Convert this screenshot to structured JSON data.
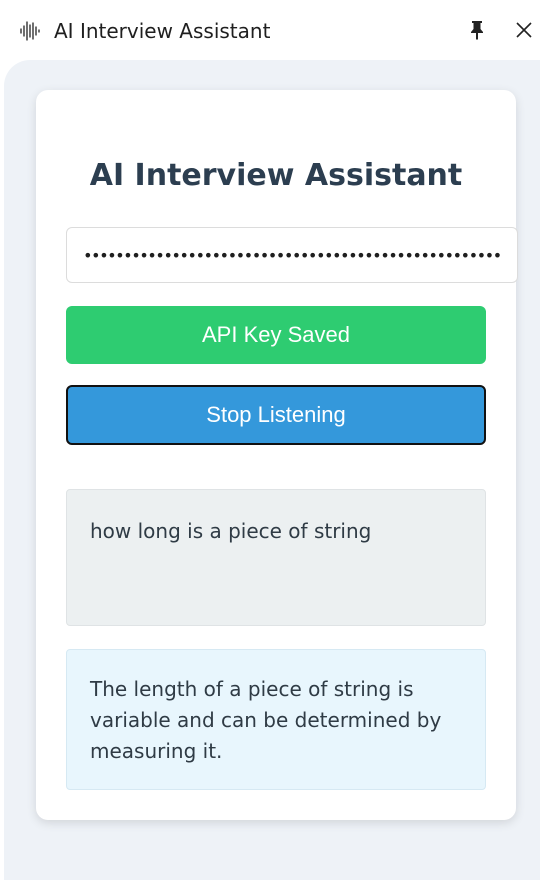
{
  "window": {
    "title": "AI Interview Assistant",
    "app_icon": "audio-waveform-icon",
    "pin_icon": "pin-icon",
    "close_icon": "close-icon"
  },
  "card": {
    "heading": "AI Interview Assistant",
    "api_key_input": {
      "value": "••••••••••••••••••••••••••••••••••••••••••••••••••••••••"
    },
    "api_key_button": {
      "label": "API Key Saved",
      "color": "#2ecc71"
    },
    "listen_button": {
      "label": "Stop Listening",
      "color": "#3498db"
    },
    "question": {
      "text": "how long is a piece of string",
      "background": "#ecf0f1"
    },
    "answer": {
      "text": "The length of a piece of string is variable and can be determined by measuring it.",
      "background": "#e8f6fd"
    }
  }
}
